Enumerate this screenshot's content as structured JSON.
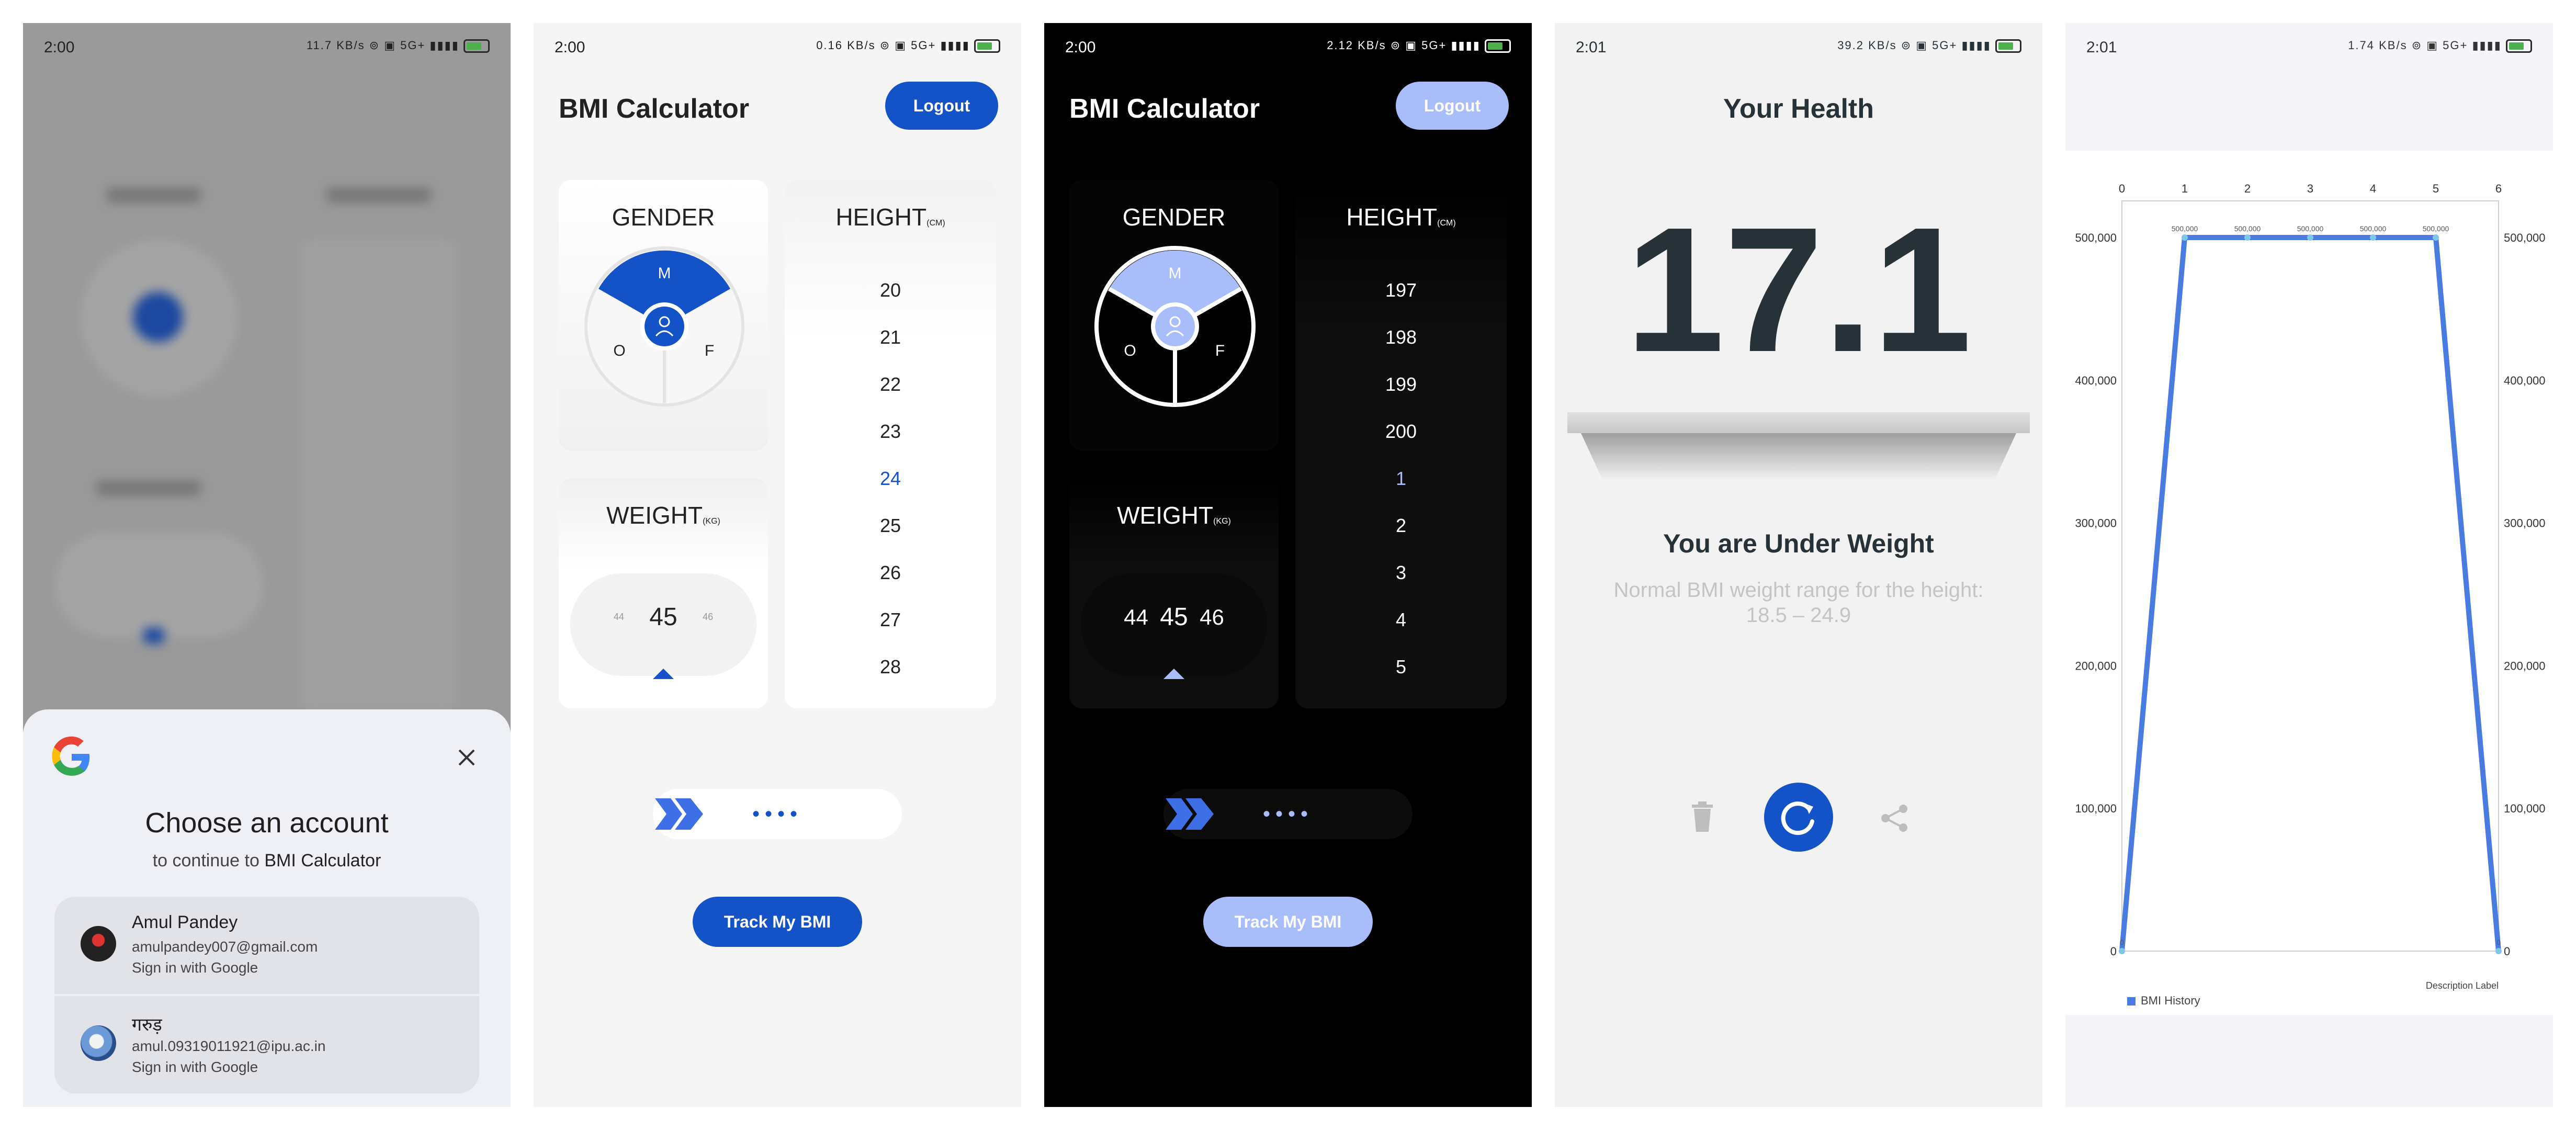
{
  "status_bars": [
    {
      "time": "2:00",
      "icons": "11.7 KB/s ⊚ ▣ 5G+ ▮▮▮▮",
      "battery": "80"
    },
    {
      "time": "2:00",
      "icons": "0.16 KB/s ⊚ ▣ 5G+ ▮▮▮▮",
      "battery": "80"
    },
    {
      "time": "2:00",
      "icons": "2.12 KB/s ⊚ ▣ 5G+ ▮▮▮▮",
      "battery": "80"
    },
    {
      "time": "2:01",
      "icons": "39.2 KB/s ⊚ ▣ 5G+ ▮▮▮▮",
      "battery": "80"
    },
    {
      "time": "2:01",
      "icons": "1.74 KB/s ⊚ ▣ 5G+ ▮▮▮▮",
      "battery": "80"
    }
  ],
  "screen1": {
    "dialog": {
      "title": "Choose an account",
      "subtitle_prefix": "to continue to ",
      "subtitle_app": "BMI Calculator",
      "accounts": [
        {
          "name": "Amul Pandey",
          "email": "amulpandey007@gmail.com",
          "action": "Sign in with Google"
        },
        {
          "name": "गरुड़",
          "email": "amul.09319011921@ipu.ac.in",
          "action": "Sign in with Google"
        }
      ]
    }
  },
  "screen2": {
    "title": "BMI Calculator",
    "logout": "Logout",
    "gender": {
      "label": "GENDER",
      "options": [
        "M",
        "O",
        "F"
      ]
    },
    "height": {
      "label": "HEIGHT",
      "unit": "(CM)",
      "values": [
        "20",
        "21",
        "22",
        "23",
        "24",
        "25",
        "26",
        "27",
        "28"
      ],
      "selected_index": 4
    },
    "weight": {
      "label": "WEIGHT",
      "unit": "(KG)",
      "prev": "44",
      "current": "45",
      "next": "46"
    },
    "track": "Track My BMI"
  },
  "screen3": {
    "title": "BMI Calculator",
    "logout": "Logout",
    "gender": {
      "label": "GENDER",
      "options": [
        "M",
        "O",
        "F"
      ]
    },
    "height": {
      "label": "HEIGHT",
      "unit": "(CM)",
      "values": [
        "197",
        "198",
        "199",
        "200",
        "1",
        "2",
        "3",
        "4",
        "5"
      ],
      "selected_index": 4
    },
    "weight": {
      "label": "WEIGHT",
      "unit": "(KG)",
      "prev": "44",
      "current": "45",
      "next": "46"
    },
    "track": "Track My BMI"
  },
  "screen4": {
    "title": "Your Health",
    "bmi": "17.1",
    "status": "You are Under Weight",
    "note": "Normal BMI weight range for the height:",
    "range": "18.5 – 24.9"
  },
  "colors": {
    "primary": "#1452c8",
    "primary_light": "#aabdfb",
    "chart_line": "#4a7be0"
  },
  "chart_data": {
    "type": "line",
    "x": [
      0,
      1,
      2,
      3,
      4,
      5,
      6
    ],
    "x_ticks": [
      "0",
      "1",
      "2",
      "3",
      "4",
      "5",
      "6"
    ],
    "y_ticks": [
      "0",
      "100,000",
      "200,000",
      "300,000",
      "400,000",
      "500,000"
    ],
    "ylim": [
      0,
      500000
    ],
    "xlim": [
      0,
      6
    ],
    "series": [
      {
        "name": "BMI History",
        "values": [
          0,
          500000,
          500000,
          500000,
          500000,
          500000,
          0
        ],
        "point_labels": [
          "0",
          "500,000",
          "500,000",
          "500,000",
          "500,000",
          "500,000",
          "0"
        ]
      }
    ],
    "description": "Description Label",
    "legend": "bottom-left"
  }
}
